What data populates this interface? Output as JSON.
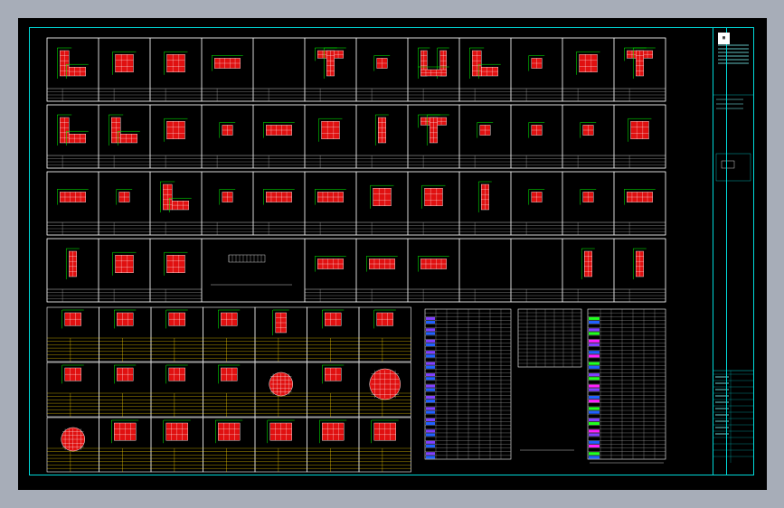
{
  "colors": {
    "background": "#000000",
    "frame": "#00d8d8",
    "panel_border": "#ffffff",
    "member_fill": "#e01010",
    "rebar": "#ffffff",
    "dimension": "#00ff00",
    "table_highlight": "#ffd700",
    "legend_purple": "#8040ff",
    "legend_magenta": "#ff20ff",
    "legend_green": "#20ff20",
    "legend_blue": "#2060ff"
  },
  "title_block": {
    "logo_icon": "company-logo-icon",
    "stamp_icon": "approval-stamp-icon"
  }
}
